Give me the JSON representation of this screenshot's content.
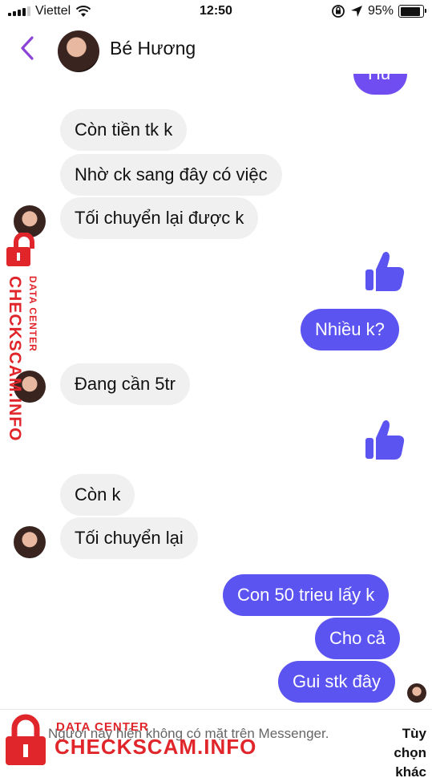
{
  "status_bar": {
    "carrier": "Viettel",
    "time": "12:50",
    "battery_percent": "95%",
    "battery_level": 0.95
  },
  "header": {
    "contact_name": "Bé Hương"
  },
  "messages": [
    {
      "side": "out",
      "text": "Hư"
    },
    {
      "side": "in",
      "text": "Còn tiền tk k"
    },
    {
      "side": "in",
      "text": "Nhờ ck sang đây có việc"
    },
    {
      "side": "in",
      "text": "Tối chuyển lại được k"
    },
    {
      "side": "in",
      "type": "like",
      "text": ""
    },
    {
      "side": "out",
      "text": "Nhiều k?"
    },
    {
      "side": "in",
      "text": "Đang cần 5tr"
    },
    {
      "side": "out",
      "type": "like",
      "text": ""
    },
    {
      "side": "in",
      "text": "Còn k"
    },
    {
      "side": "in",
      "text": "Tối chuyển lại"
    },
    {
      "side": "out",
      "text": "Con 50 trieu lấy k"
    },
    {
      "side": "out",
      "text": "Cho cả"
    },
    {
      "side": "out",
      "text": "Gui stk đây"
    }
  ],
  "footer": {
    "notice": "Người này hiện không có mặt trên Messenger.",
    "action": "Tùy chọn khác"
  },
  "watermark": {
    "line1": "DATA CENTER",
    "line2": "CHECKSCAM.INFO",
    "color": "#e0262b"
  },
  "colors": {
    "accent": "#5b54f0",
    "incoming_bubble": "#f0f0f0",
    "back_arrow": "#8a44d6"
  },
  "icons": [
    "signal-icon",
    "wifi-icon",
    "orientation-lock-icon",
    "location-icon",
    "battery-icon",
    "back-chevron-icon",
    "thumbs-up-icon",
    "lock-icon"
  ]
}
